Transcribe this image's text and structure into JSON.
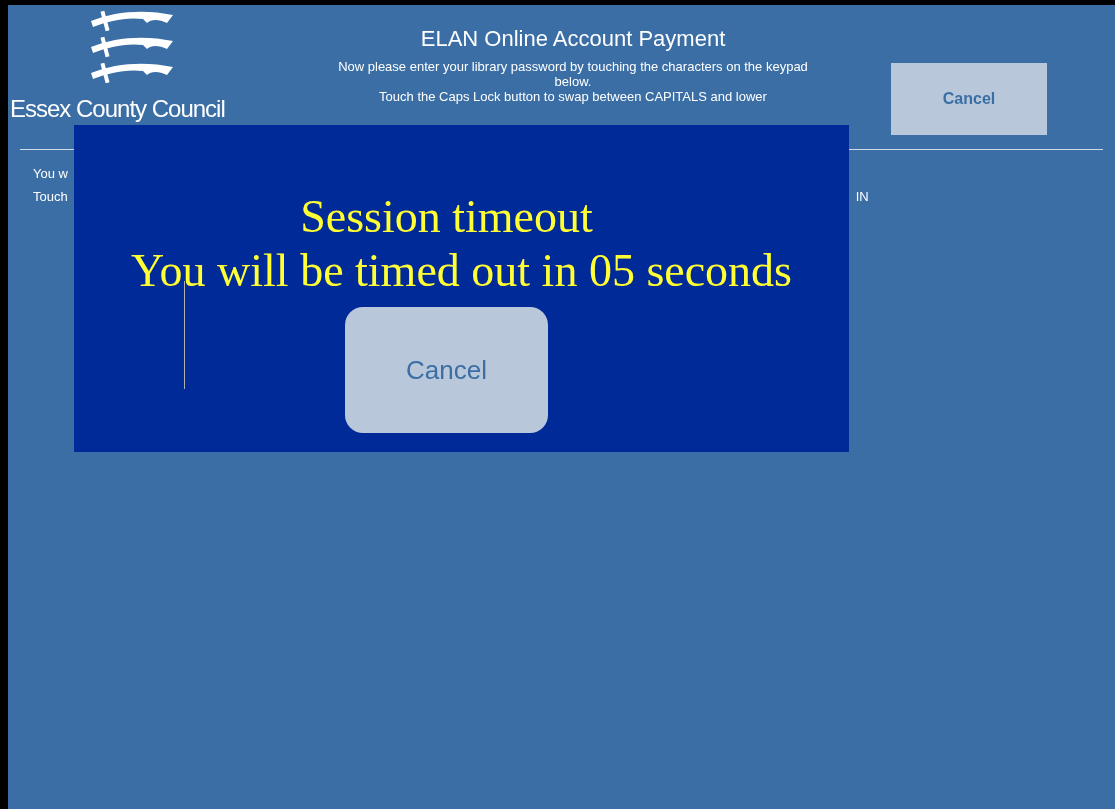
{
  "header": {
    "logo_text": "Essex County Council",
    "title": "ELAN Online Account Payment",
    "instructions": [
      "Now please enter your library password by touching the characters on the keypad below.",
      "Touch the Caps Lock button to swap between CAPITALS and lower"
    ],
    "cancel_button": "Cancel"
  },
  "background_text": {
    "line_1": "You w",
    "line_2": "Touch",
    "line_2_end": "IN"
  },
  "timeout_dialog": {
    "title": "Session timeout",
    "message": "You will be timed out in 05 seconds",
    "cancel_button": "Cancel"
  }
}
